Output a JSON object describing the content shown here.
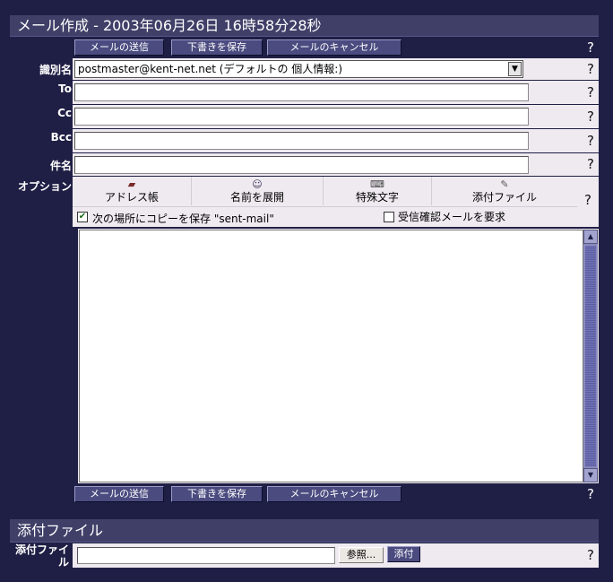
{
  "header": {
    "title": "メール作成 - 2003年06月26日 16時58分28秒"
  },
  "actions": {
    "send": "メールの送信",
    "save_draft": "下書きを保存",
    "cancel": "メールのキャンセル"
  },
  "help_glyph": "?",
  "fields": {
    "identity": {
      "label": "識別名",
      "value": "postmaster@kent-net.net (デフォルトの 個人情報:)"
    },
    "to": {
      "label": "To",
      "value": ""
    },
    "cc": {
      "label": "Cc",
      "value": ""
    },
    "bcc": {
      "label": "Bcc",
      "value": ""
    },
    "subject": {
      "label": "件名",
      "value": ""
    }
  },
  "options": {
    "label": "オプション",
    "tools": [
      {
        "label": "アドレス帳",
        "icon": "address-book-icon"
      },
      {
        "label": "名前を展開",
        "icon": "people-icon"
      },
      {
        "label": "特殊文字",
        "icon": "keyboard-icon"
      },
      {
        "label": "添付ファイル",
        "icon": "paperclip-icon"
      }
    ],
    "save_copy": {
      "label": "次の場所にコピーを保存 \"sent-mail\"",
      "checked": true
    },
    "read_receipt": {
      "label": "受信確認メールを要求",
      "checked": false
    }
  },
  "body": {
    "value": ""
  },
  "attachments": {
    "section_title": "添付ファイル",
    "label": "添付ファイル",
    "browse": "参照...",
    "attach": "添付",
    "value": ""
  },
  "colors": {
    "background": "#1f1f45",
    "titlebar": "#3f3f68",
    "button": "#4b4b80",
    "cell": "#efeaf0",
    "scrollbar": "#8a8abf"
  }
}
